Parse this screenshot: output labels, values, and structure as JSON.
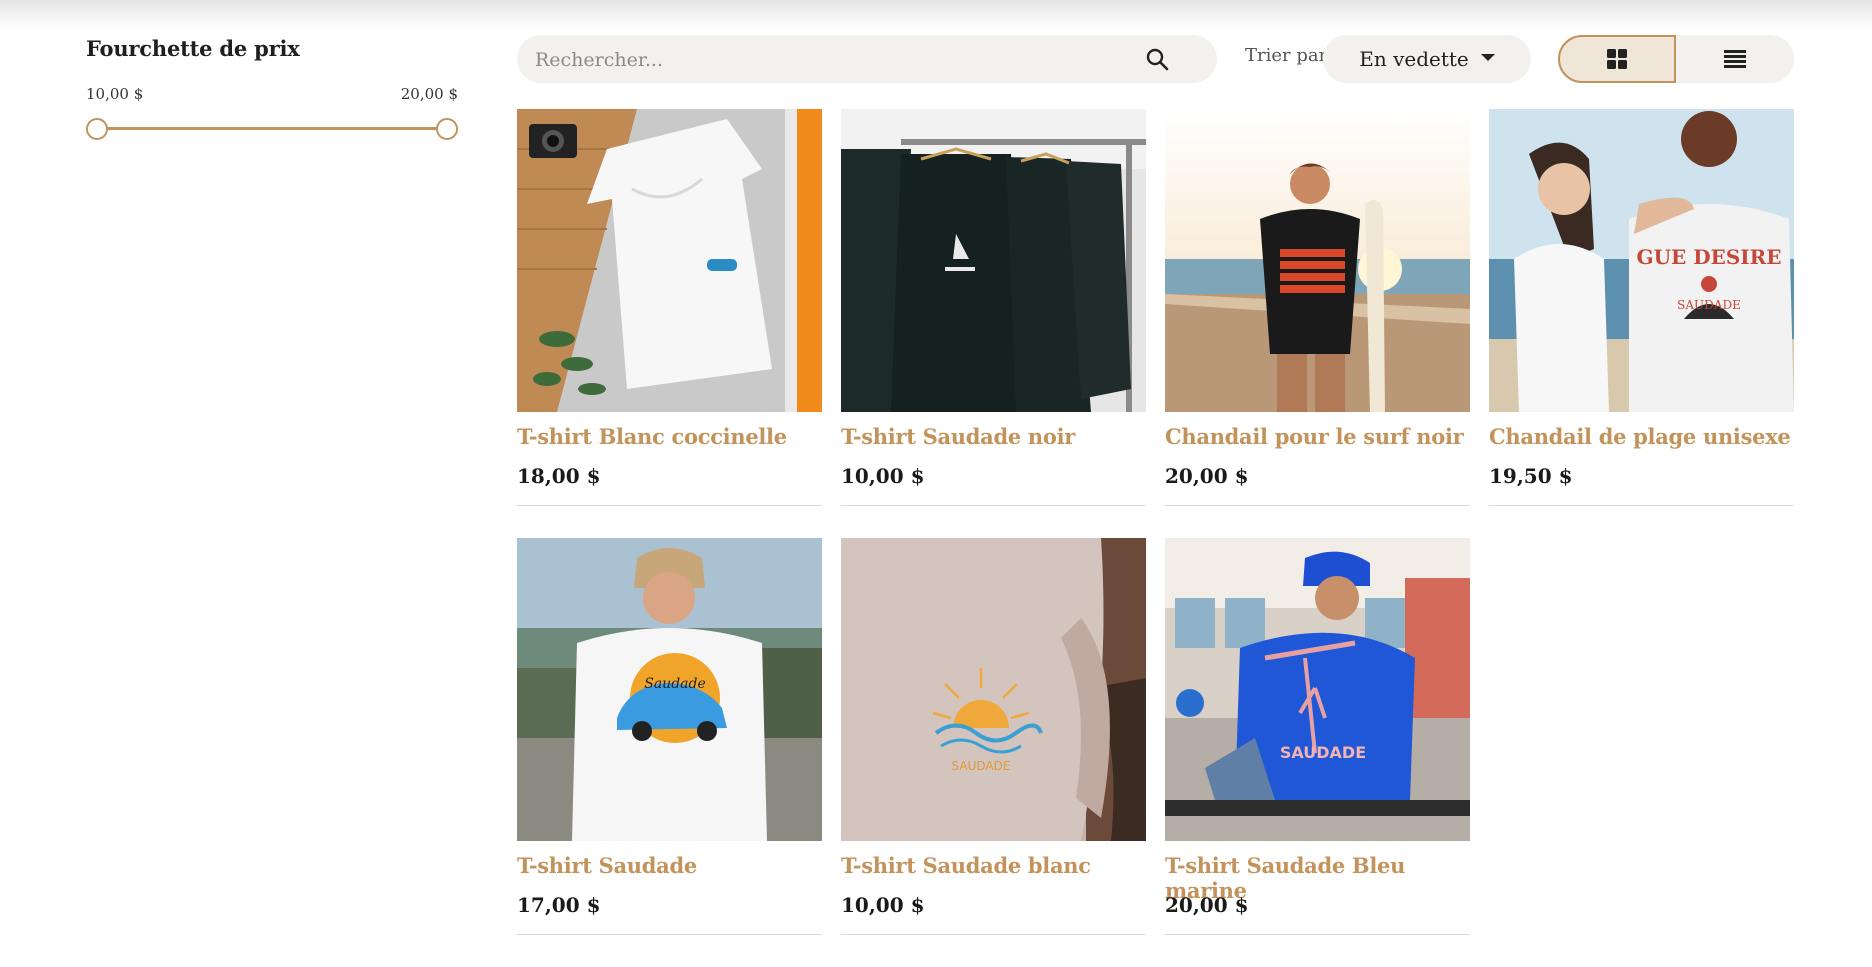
{
  "filters": {
    "title": "Fourchette de prix",
    "min_label": "10,00 $",
    "max_label": "20,00 $"
  },
  "toolbar": {
    "search_placeholder": "Rechercher...",
    "sort_label": "Trier par :",
    "sort_value": "En vedette"
  },
  "colors": {
    "accent": "#c2935a",
    "pill_bg": "#f3f1ee"
  },
  "products": [
    {
      "name": "T-shirt Blanc coccinelle",
      "price": "18,00 $"
    },
    {
      "name": "T-shirt Saudade noir",
      "price": "10,00 $"
    },
    {
      "name": "Chandail pour le surf noir",
      "price": "20,00 $"
    },
    {
      "name": "Chandail de plage unisexe",
      "price": "19,50 $"
    },
    {
      "name": "T-shirt Saudade",
      "price": "17,00 $"
    },
    {
      "name": "T-shirt Saudade blanc",
      "price": "10,00 $"
    },
    {
      "name": "T-shirt Saudade Bleu marine",
      "price": "20,00 $"
    }
  ]
}
